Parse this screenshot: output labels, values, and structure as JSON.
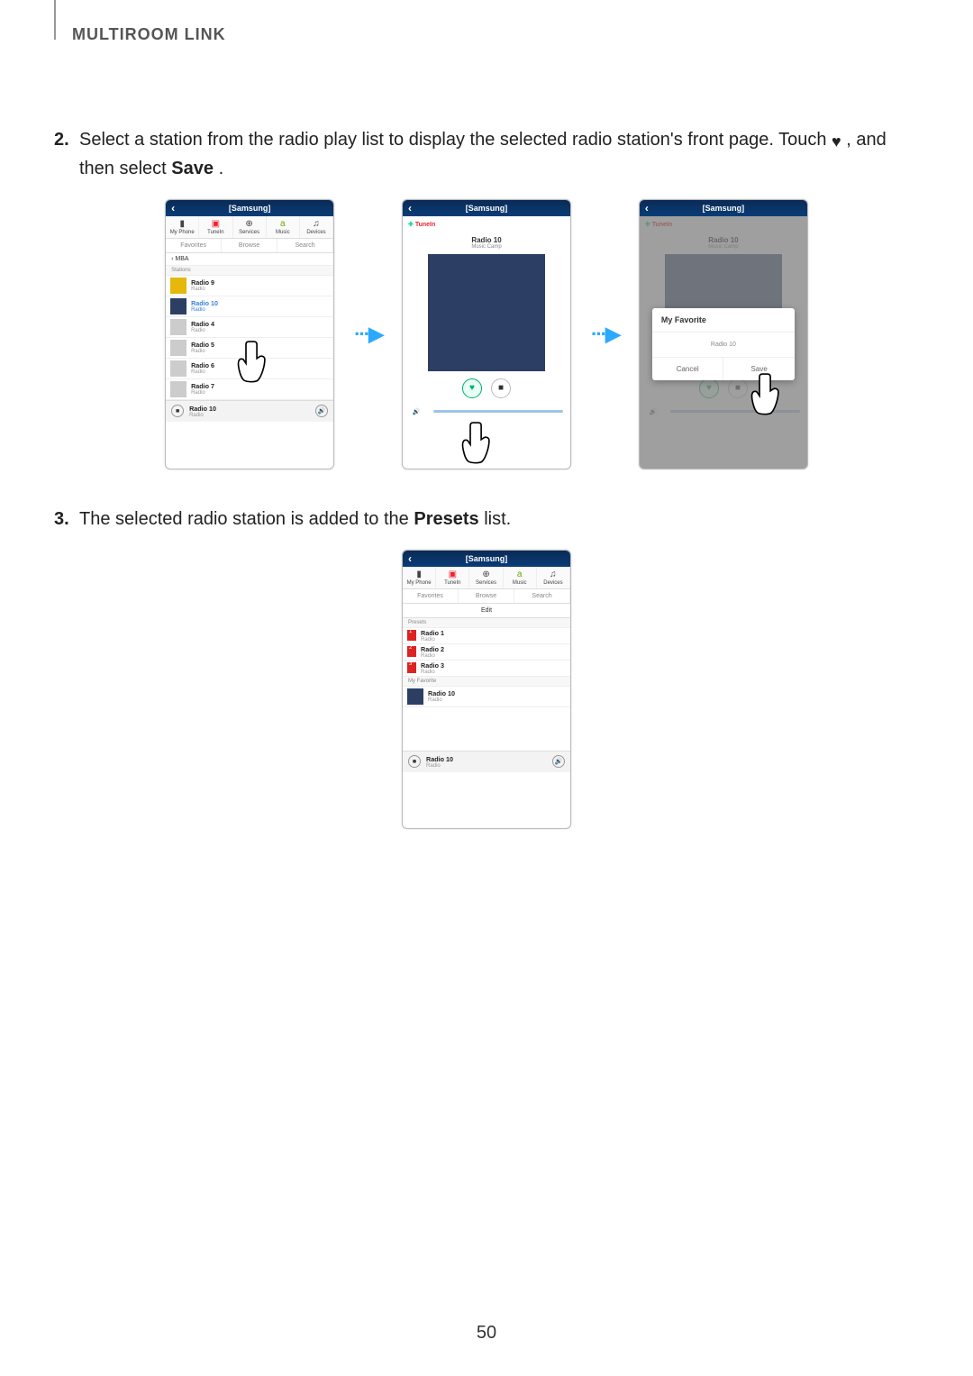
{
  "header": {
    "title": "MULTIROOM LINK"
  },
  "page_number": "50",
  "steps": {
    "s2": {
      "num": "2.",
      "text_a": "Select a station from the radio play list to display the selected radio station's front page. Touch ",
      "heart": "♥",
      "text_b": ", and then select ",
      "bold": "Save",
      "text_c": "."
    },
    "s3": {
      "num": "3.",
      "text_a": "The selected radio station is added to the ",
      "bold": "Presets",
      "text_b": " list."
    }
  },
  "arrow": "···▶",
  "phone_list": {
    "title": "[Samsung]",
    "tabs": [
      "My Phone",
      "TuneIn",
      "Services",
      "Music",
      "Devices"
    ],
    "subtabs": [
      "Favorites",
      "Browse",
      "Search"
    ],
    "breadcrumb": "‹  MBA",
    "section": "Stations",
    "stations": [
      {
        "t": "Radio 9",
        "s": "Radio",
        "thumb": "gold"
      },
      {
        "t": "Radio 10",
        "s": "Radio",
        "thumb": "navy",
        "sel": true
      },
      {
        "t": "Radio 4",
        "s": "Radio"
      },
      {
        "t": "Radio 5",
        "s": "Radio"
      },
      {
        "t": "Radio 6",
        "s": "Radio"
      },
      {
        "t": "Radio 7",
        "s": "Radio"
      }
    ],
    "now": {
      "t": "Radio 10",
      "s": "Radio"
    }
  },
  "phone_player": {
    "title": "[Samsung]",
    "service": "TuneIn",
    "np_title": "Radio 10",
    "np_sub": "Music Camp",
    "stop": "■"
  },
  "phone_modal": {
    "title": "[Samsung]",
    "service": "TuneIn",
    "np_title": "Radio 10",
    "np_sub": "Music Camp",
    "modal_head": "My Favorite",
    "modal_body": "Radio 10",
    "cancel": "Cancel",
    "save": "Save"
  },
  "phone_fav": {
    "title": "[Samsung]",
    "tabs": [
      "My Phone",
      "TuneIn",
      "Services",
      "Music",
      "Devices"
    ],
    "subtabs": [
      "Favorites",
      "Browse",
      "Search"
    ],
    "edit": "Edit",
    "presets_label": "Presets",
    "presets": [
      {
        "n": "1",
        "t": "Radio 1",
        "s": "Radio"
      },
      {
        "n": "2",
        "t": "Radio 2",
        "s": "Radio"
      },
      {
        "n": "3",
        "t": "Radio 3",
        "s": "Radio"
      }
    ],
    "myfav_label": "My Favorite",
    "myfav": {
      "t": "Radio 10",
      "s": "Radio"
    },
    "now": {
      "t": "Radio 10",
      "s": "Radio"
    }
  }
}
